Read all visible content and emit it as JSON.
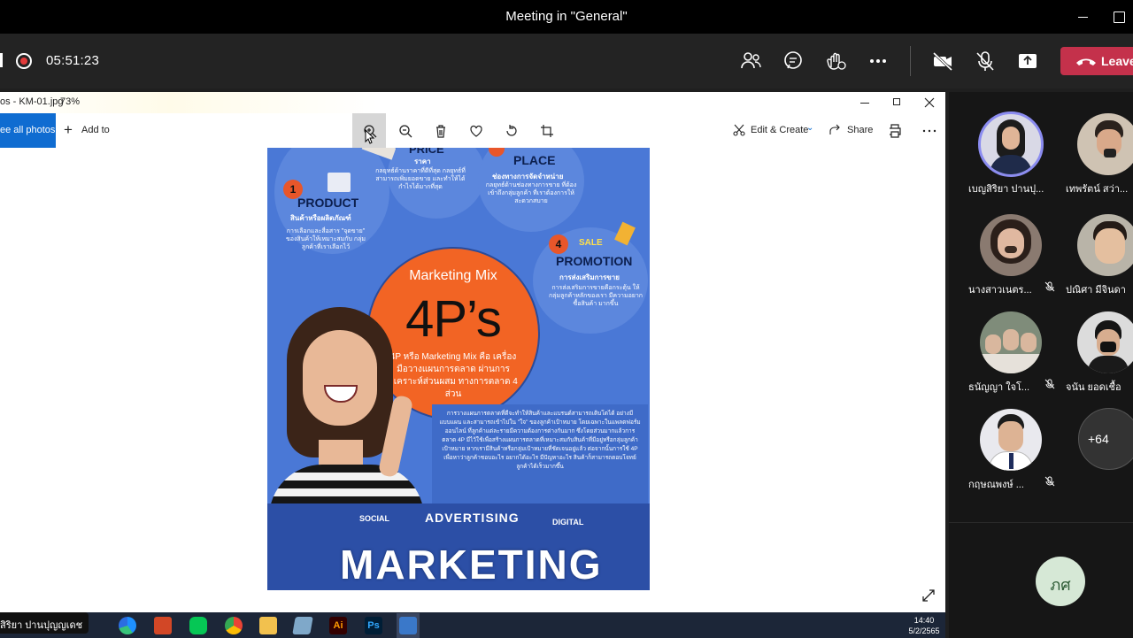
{
  "window": {
    "title": "Meeting in \"General\""
  },
  "call": {
    "timer": "05:51:23",
    "leave_label": "Leave"
  },
  "photos": {
    "title": "os - KM-01.jpg",
    "zoom": "73%",
    "see_all_label": "ee all photos",
    "add_to_label": "Add to",
    "edit_create_label": "Edit & Create",
    "share_label": "Share"
  },
  "poster": {
    "price_head": "PRICE",
    "price_thai": "ราคา",
    "price_body": "กลยุทธ์ด้านราคาที่ดีที่สุด กลยุทธ์ที่สามารถเพิ่มยอดขาย และทำให้ได้กำไรได้มากที่สุด",
    "place_head": "PLACE",
    "place_thai": "ช่องทางการจัดจำหน่าย",
    "place_body": "กลยุทธ์ด้านช่องทางการขาย ที่ต้องเข้าถึงกลุ่มลูกค้า ที่เราต้องการให้สะดวกสบาย",
    "product_num": "1",
    "product_head": "PRODUCT",
    "product_thai": "สินค้าหรือผลิตภัณฑ์",
    "product_body": "การเลือกและสื่อสาร \"จุดขาย\" ของสินค้าให้เหมาะสมกับ กลุ่มลูกค้าที่เราเลือกไว้",
    "promotion_num": "4",
    "promotion_sale": "SALE",
    "promotion_head": "PROMOTION",
    "promotion_thai": "การส่งเสริมการขาย",
    "promotion_body": "การส่งเสริมการขายคือกระตุ้น ให้กลุ่มลูกค้าหลักของเรา มีความอยากซื้อสินค้า มากขึ้น",
    "circle_title": "Marketing Mix",
    "circle_big": "4P’s",
    "circle_desc": "4P หรือ Marketing Mix คือ เครื่องมือวางแผนการตลาด ผ่านการวิเคราะห์ส่วนผสม ทางการตลาด 4 ส่วน",
    "panel_body": "การวางแผนการตลาดที่ดีจะทำให้สินค้าและแบรนด์สามารถเติบโตได้ อย่างมีแบบแผน และสามารถเข้าไปใน \"ใจ\" ของลูกค้าเป้าหมาย โดยเฉพาะในแพลตฟอร์มออนไลน์ ที่ลูกค้าแต่ละรายมีความต้องการต่างกันมาก ซึ่งโดยส่วนมากแล้วการตลาด 4P มีไว้ใช้เพื่อสร้างแผนการตลาดที่เหมาะสมกับสินค้าที่มีอยู่หรือกลุ่มลูกค้าเป้าหมาย หากเรามีสินค้าหรือกลุ่มเป้าหมายที่ชัดเจนอยู่แล้ว ต่อจากนั้นการใช้ 4P เพื่อหาว่าลูกค้าชอบอะไร อยากได้อะไร มีปัญหาอะไร สินค้าก็สามารถตอบโจทย์ลูกค้าได้เร็วมากขึ้น",
    "social": "SOCIAL",
    "advertising": "ADVERTISING",
    "digital": "DIGITAL",
    "marketing": "MARKETING"
  },
  "participants": [
    {
      "name": "เบญสิริยา ปานปุ...",
      "muted": false,
      "speaking": true
    },
    {
      "name": "เทพรัตน์ สว่า...",
      "muted": false,
      "speaking": false
    },
    {
      "name": "นางสาวเนตร...",
      "muted": true,
      "speaking": false
    },
    {
      "name": "ปณิศา มีจินดา",
      "muted": false,
      "speaking": false
    },
    {
      "name": "ธนัญญา ใจโ...",
      "muted": true,
      "speaking": false
    },
    {
      "name": "จนัน ยอดเชื้อ",
      "muted": false,
      "speaking": false
    },
    {
      "name": "กฤษณพงษ์ ...",
      "muted": true,
      "speaking": false
    }
  ],
  "more_count": "+64",
  "local_initials": "ภศ",
  "presenter_name": "สิริยา ปานปุญญเดช",
  "taskbar": {
    "time": "14:40",
    "date": "5/2/2565"
  },
  "colors": {
    "leave": "#c4314b",
    "accent": "#0f6cd1",
    "speaking_ring": "#8b8cf0"
  }
}
